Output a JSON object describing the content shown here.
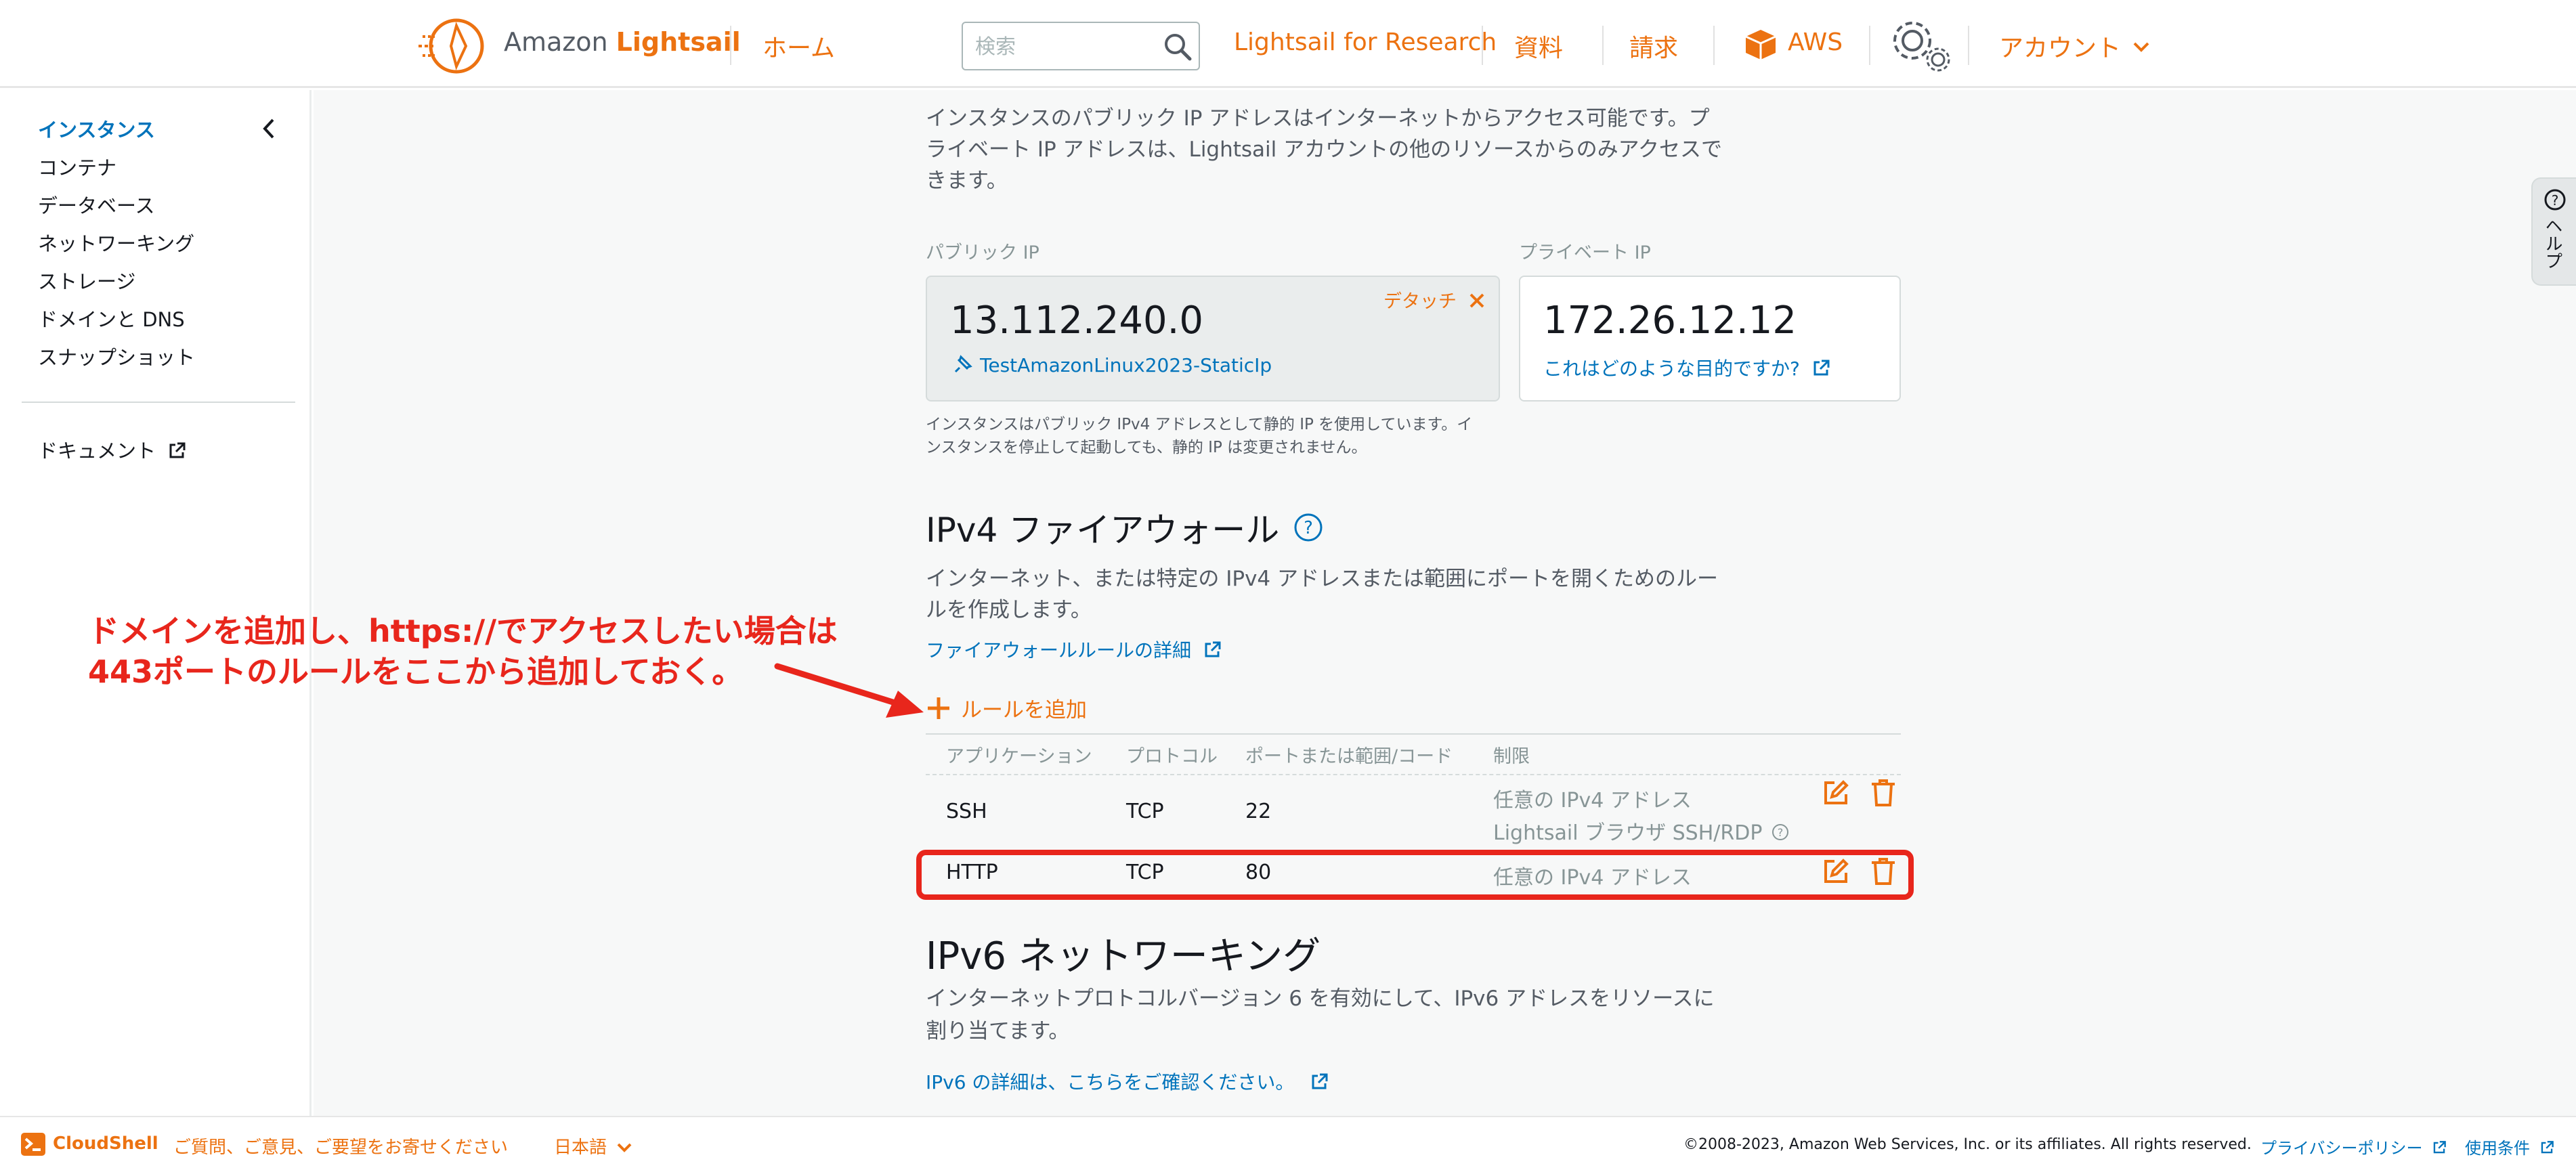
{
  "brand": {
    "prefix": "Amazon ",
    "name": "Lightsail"
  },
  "nav": {
    "home": "ホーム",
    "search_placeholder": "検索",
    "research": "Lightsail for Research",
    "docs": "資料",
    "billing": "請求",
    "aws": "AWS",
    "account": "アカウント"
  },
  "sidebar": {
    "items": [
      "インスタンス",
      "コンテナ",
      "データベース",
      "ネットワーキング",
      "ストレージ",
      "ドメインと DNS",
      "スナップショット"
    ],
    "documents": "ドキュメント"
  },
  "networking": {
    "intro_line1": "インスタンスのパブリック IP アドレスはインターネットからアクセス可能です。プ",
    "intro_line2": "ライベート IP アドレスは、Lightsail アカウントの他のリソースからのみアクセスで",
    "intro_line3": "きます。",
    "public_ip_label": "パブリック IP",
    "public_ip": "13.112.240.0",
    "detach": "デタッチ",
    "static_ip_name": "TestAmazonLinux2023-StaticIp",
    "private_ip_label": "プライベート IP",
    "private_ip": "172.26.12.12",
    "private_ip_link": "これはどのような目的ですか?",
    "static_note_line1": "インスタンスはパブリック IPv4 アドレスとして静的 IP を使用しています。イ",
    "static_note_line2": "ンスタンスを停止して起動しても、静的 IP は変更されません。"
  },
  "firewall": {
    "title": "IPv4 ファイアウォール",
    "desc_line1": "インターネット、または特定の IPv4 アドレスまたは範囲にポートを開くためのルー",
    "desc_line2": "ルを作成します。",
    "details_link": "ファイアウォールルールの詳細",
    "add_rule": "ルールを追加",
    "columns": [
      "アプリケーション",
      "プロトコル",
      "ポートまたは範囲/コード",
      "制限"
    ],
    "rows": [
      {
        "app": "SSH",
        "protocol": "TCP",
        "port": "22",
        "restriction": "任意の IPv4 アドレス",
        "restriction2": "Lightsail ブラウザ SSH/RDP"
      },
      {
        "app": "HTTP",
        "protocol": "TCP",
        "port": "80",
        "restriction": "任意の IPv4 アドレス"
      }
    ]
  },
  "ipv6": {
    "title": "IPv6 ネットワーキング",
    "desc_line1": "インターネットプロトコルバージョン 6 を有効にして、IPv6 アドレスをリソースに",
    "desc_line2": "割り当てます。",
    "details_link": "IPv6 の詳細は、こちらをご確認ください。"
  },
  "footer": {
    "cloudshell": "CloudShell",
    "feedback": "ご質問、ご意見、ご要望をお寄せください",
    "language": "日本語",
    "copyright": "©2008-2023, Amazon Web Services, Inc. or its affiliates. All rights reserved.",
    "privacy": "プライバシーポリシー",
    "terms": "使用条件"
  },
  "help_tab": "ヘルプ",
  "annotation": {
    "line1": "ドメインを追加し、https://でアクセスしたい場合は",
    "line2": "443ポートのルールをここから追加しておく。"
  },
  "colors": {
    "accent": "#ec7211",
    "link": "#0073bb",
    "annotation": "#e8261c"
  },
  "icons": [
    "lightsail-logo-icon",
    "search-icon",
    "aws-box-icon",
    "gear-icon",
    "chevron-down-icon",
    "chevron-left-icon",
    "external-link-icon",
    "static-ip-pin-icon",
    "close-icon",
    "info-icon",
    "plus-icon",
    "edit-icon",
    "trash-icon",
    "cloudshell-icon",
    "help-icon"
  ]
}
